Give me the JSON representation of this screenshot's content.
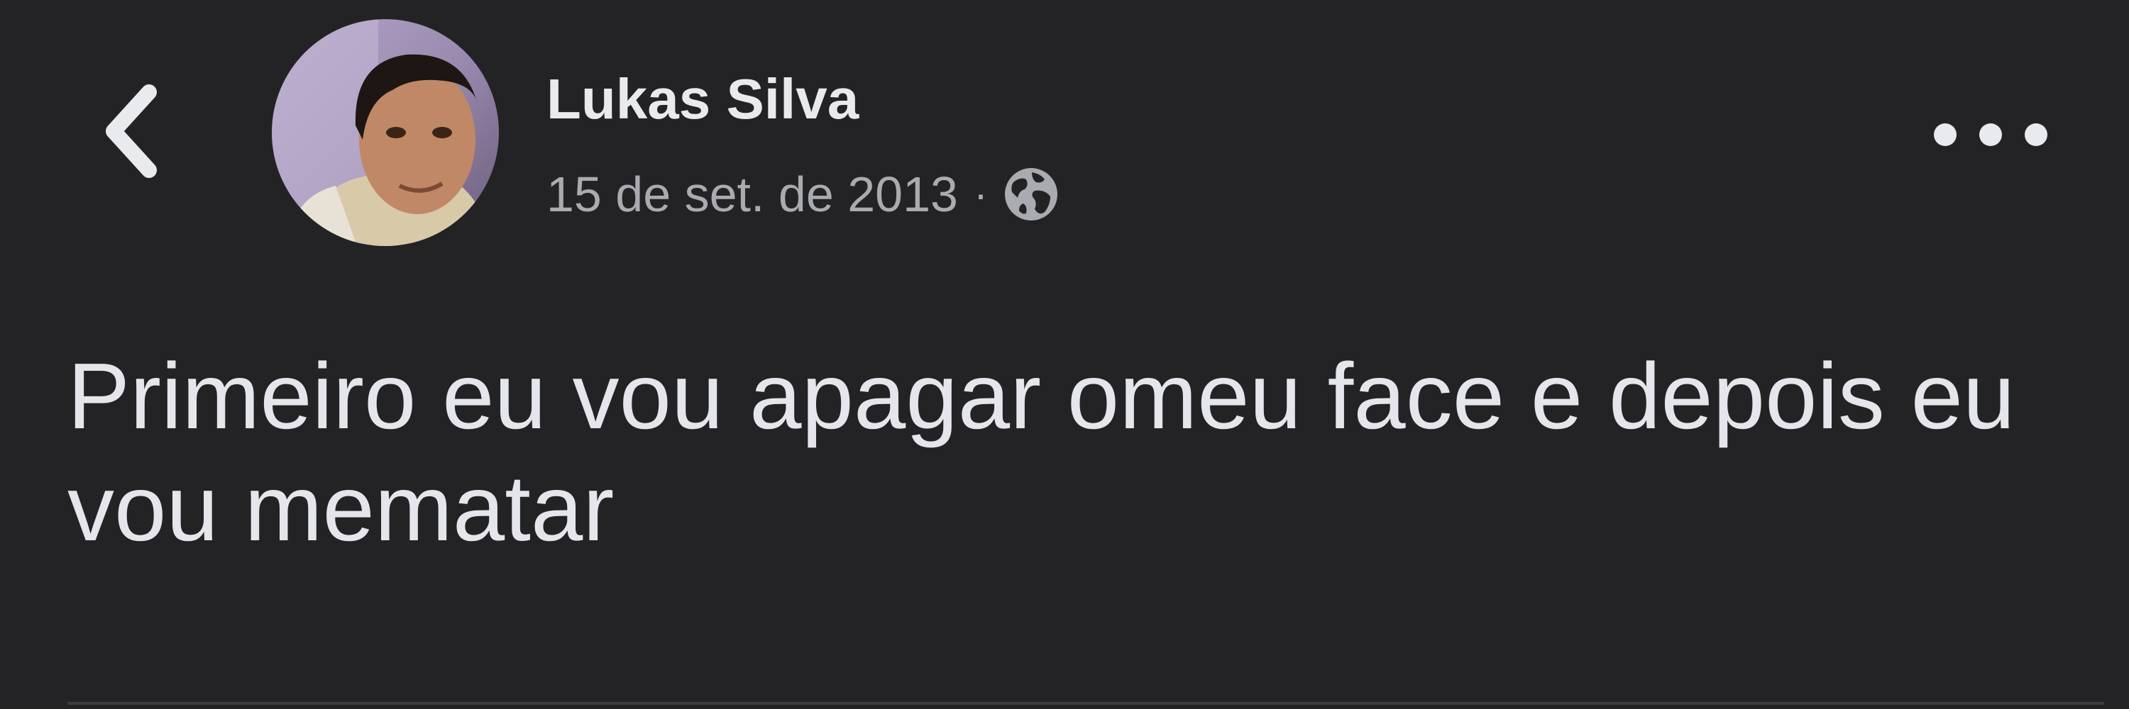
{
  "post": {
    "author": {
      "name": "Lukas Silva",
      "avatar": "profile-photo"
    },
    "date": "15 de set. de 2013",
    "separator": "·",
    "privacy_icon": "globe-icon",
    "text": "Primeiro eu vou apagar omeu face e depois eu vou mematar"
  },
  "toolbar": {
    "back_icon": "chevron-left-icon",
    "more_icon": "more-horizontal-icon"
  },
  "colors": {
    "background": "#232325",
    "primary_text": "#e4e6eb",
    "secondary_text": "#a9abb0",
    "divider": "#3b3c3f"
  }
}
